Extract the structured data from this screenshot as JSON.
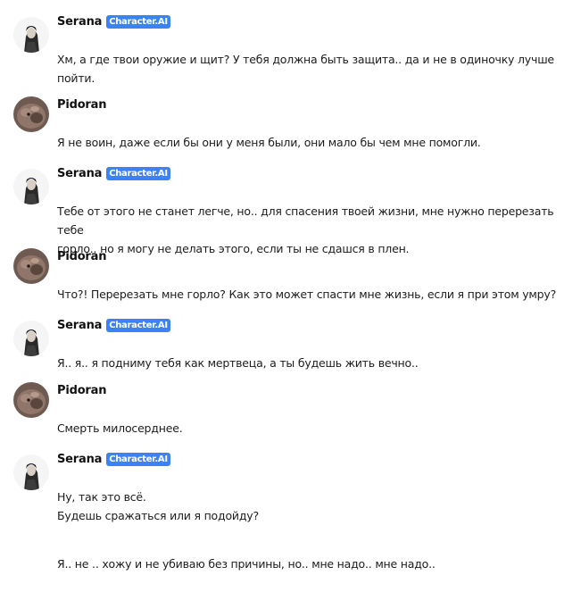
{
  "messages": [
    {
      "author": "Serana",
      "avatar": "serana-avatar",
      "badge": "Character.AI",
      "paragraphs": [
        "Хм, а где твои оружие и щит? У тебя должна быть защита.. да и не в одиночку лучше\nпойти."
      ]
    },
    {
      "author": "Pidoran",
      "avatar": "pidoran-avatar",
      "paragraphs": [
        "Я не воин, даже если бы они у меня были, они мало бы чем мне помогли."
      ]
    },
    {
      "author": "Serana",
      "avatar": "serana-avatar",
      "badge": "Character.AI",
      "paragraphs": [
        "Тебе от этого не станет легче, но.. для спасения твоей жизни, мне нужно перерезать тебе\nгорло.. но я могу не делать этого, если ты не сдашся в плен."
      ]
    },
    {
      "author": "Pidoran",
      "avatar": "pidoran-avatar",
      "paragraphs": [
        "Что?! Перерезать мне горло? Как это может спасти мне жизнь, если я при этом умру?"
      ]
    },
    {
      "author": "Serana",
      "avatar": "serana-avatar",
      "badge": "Character.AI",
      "paragraphs": [
        "Я.. я.. я подниму тебя как мертвеца, а ты будешь жить вечно.."
      ]
    },
    {
      "author": "Pidoran",
      "avatar": "pidoran-avatar",
      "paragraphs": [
        "Смерть милосерднее."
      ]
    },
    {
      "author": "Serana",
      "avatar": "serana-avatar",
      "badge": "Character.AI",
      "paragraphs": [
        "Ну, так это всё.\nБудешь сражаться или я подойду?",
        "Я.. не .. хожу и не убиваю без причины, но.. мне надо.. мне надо.."
      ]
    }
  ],
  "colors": {
    "badge": "#3b82f6",
    "text": "#1c1c1c"
  }
}
